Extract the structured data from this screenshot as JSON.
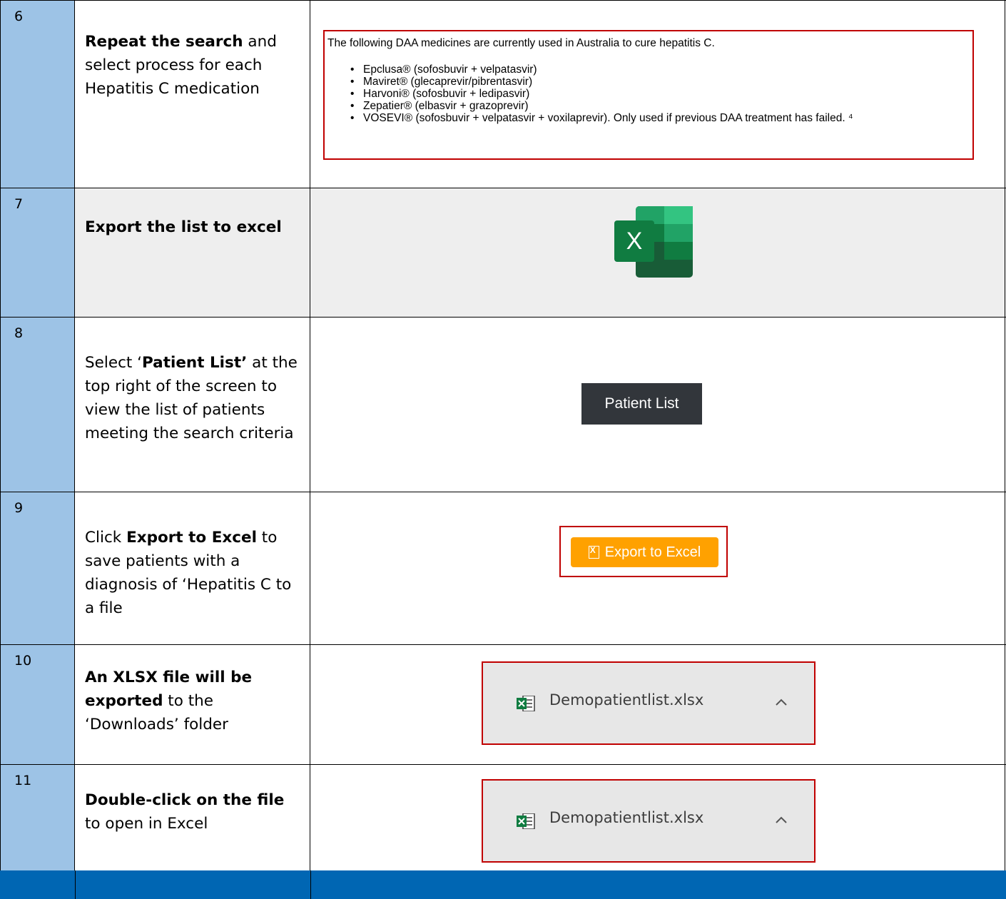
{
  "rows": [
    {
      "num": "6",
      "desc": [
        {
          "t": "Repeat the search",
          "b": true
        },
        {
          "t": " and select process for each Hepatitis C medication",
          "b": false
        }
      ],
      "daa": {
        "intro": "The following DAA medicines are currently used in Australia to cure hepatitis C.",
        "items": [
          "Epclusa® (sofosbuvir + velpatasvir)",
          "Maviret® (glecaprevir/pibrentasvir)",
          "Harvoni® (sofosbuvir + ledipasvir)",
          "Zepatier® (elbasvir + grazoprevir)",
          "VOSEVI® (sofosbuvir + velpatasvir + voxilaprevir). Only used if previous DAA treatment has failed. ⁴"
        ]
      }
    },
    {
      "num": "7",
      "desc": [
        {
          "t": "Export the list to excel",
          "b": true
        }
      ],
      "logo_letter": "X"
    },
    {
      "num": "8",
      "desc": [
        {
          "t": "Select ‘",
          "b": false
        },
        {
          "t": "Patient List’",
          "b": true
        },
        {
          "t": " at the top right of the screen to view the list of patients meeting the search criteria",
          "b": false
        }
      ],
      "button_label": "Patient List"
    },
    {
      "num": "9",
      "desc": [
        {
          "t": "Click ",
          "b": false
        },
        {
          "t": "Export to Excel",
          "b": true
        },
        {
          "t": " to save patients with a diagnosis of ‘Hepatitis C to a file",
          "b": false
        }
      ],
      "button_label": "Export to Excel"
    },
    {
      "num": "10",
      "desc": [
        {
          "t": "An XLSX file will be exported",
          "b": true
        },
        {
          "t": " to the ‘Downloads’ folder",
          "b": false
        }
      ],
      "file_name": "Demopatientlist.xlsx"
    },
    {
      "num": "11",
      "desc": [
        {
          "t": "Double-click on the file",
          "b": true
        },
        {
          "t": " to open in Excel",
          "b": false
        }
      ],
      "file_name": "Demopatientlist.xlsx"
    }
  ],
  "colors": {
    "step_column": "#9dc3e6",
    "footer": "#0066b3",
    "highlight_border": "#c00000",
    "export_button": "#ffa100",
    "patient_list_button": "#32363b",
    "excel_green": "#107c41"
  }
}
